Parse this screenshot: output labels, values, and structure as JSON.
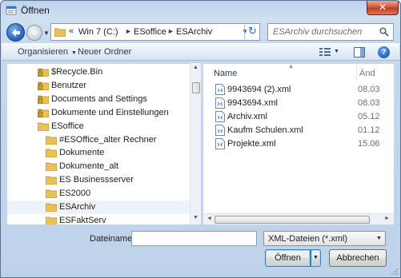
{
  "window": {
    "title": "Öffnen",
    "close_label": "✕"
  },
  "address": {
    "crumbs": [
      "Win 7 (C:)",
      "ESoffice",
      "ESArchiv"
    ],
    "overflow": "«"
  },
  "search": {
    "placeholder": "ESArchiv durchsuchen"
  },
  "toolbar": {
    "organize": "Organisieren",
    "new_folder": "Neuer Ordner",
    "help": "?"
  },
  "tree": [
    {
      "label": "$Recycle.Bin",
      "icon": "locked-folder-icon"
    },
    {
      "label": "Benutzer",
      "icon": "locked-folder-icon"
    },
    {
      "label": "Documents and Settings",
      "icon": "locked-folder-icon"
    },
    {
      "label": "Dokumente und Einstellungen",
      "icon": "locked-folder-icon"
    },
    {
      "label": "ESoffice",
      "icon": "folder-icon"
    },
    {
      "label": "#ESOffice_alter Rechner",
      "icon": "folder-icon"
    },
    {
      "label": "Dokumente",
      "icon": "folder-icon"
    },
    {
      "label": "Dokumente_alt",
      "icon": "folder-icon"
    },
    {
      "label": "ES Businessserver",
      "icon": "folder-icon"
    },
    {
      "label": "ES2000",
      "icon": "folder-icon"
    },
    {
      "label": "ESArchiv",
      "icon": "folder-icon",
      "selected": true
    },
    {
      "label": "ESFaktServ",
      "icon": "folder-icon"
    }
  ],
  "columns": {
    "name": "Name",
    "date": "Änd"
  },
  "files": [
    {
      "name": "9943694 (2).xml",
      "date": "08.03"
    },
    {
      "name": "9943694.xml",
      "date": "08.03"
    },
    {
      "name": "Archiv.xml",
      "date": "05.12"
    },
    {
      "name": "Kaufm Schulen.xml",
      "date": "01.12"
    },
    {
      "name": "Projekte.xml",
      "date": "15.06"
    }
  ],
  "footer": {
    "filename_label": "Dateiname:",
    "filename_value": "",
    "filetype": "XML-Dateien (*.xml)",
    "open_label": "Öffnen",
    "cancel_label": "Abbrechen"
  },
  "colors": {
    "accent": "#2d6bc2",
    "folder": "#e8c15a",
    "selection": "#eef3fa"
  }
}
